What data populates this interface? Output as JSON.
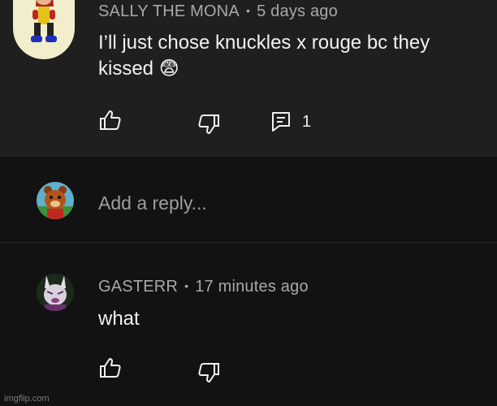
{
  "comment": {
    "author": "SALLY THE MONA",
    "separator": "•",
    "timestamp": "5 days ago",
    "text_line1": "I’ll just chose knuckles x rouge bc they",
    "text_line2": "kissed 😨",
    "reply_count": "1",
    "avatar_icon": "character-avatar-red-hedgehog",
    "like_icon": "thumbs-up-icon",
    "dislike_icon": "thumbs-down-icon",
    "replies_icon": "comment-icon"
  },
  "reply_box": {
    "placeholder": "Add a reply...",
    "avatar_icon": "character-avatar-bear"
  },
  "reply": {
    "author": "GASTERR",
    "separator": "•",
    "timestamp": "17 minutes ago",
    "text": "what",
    "avatar_icon": "character-avatar-rabbit"
  },
  "watermark": "imgflip.com",
  "colors": {
    "comment_bg": "#1f1f1f",
    "page_bg": "#121212",
    "meta_text": "#a8a8a8",
    "body_text": "#f1f1f1"
  }
}
